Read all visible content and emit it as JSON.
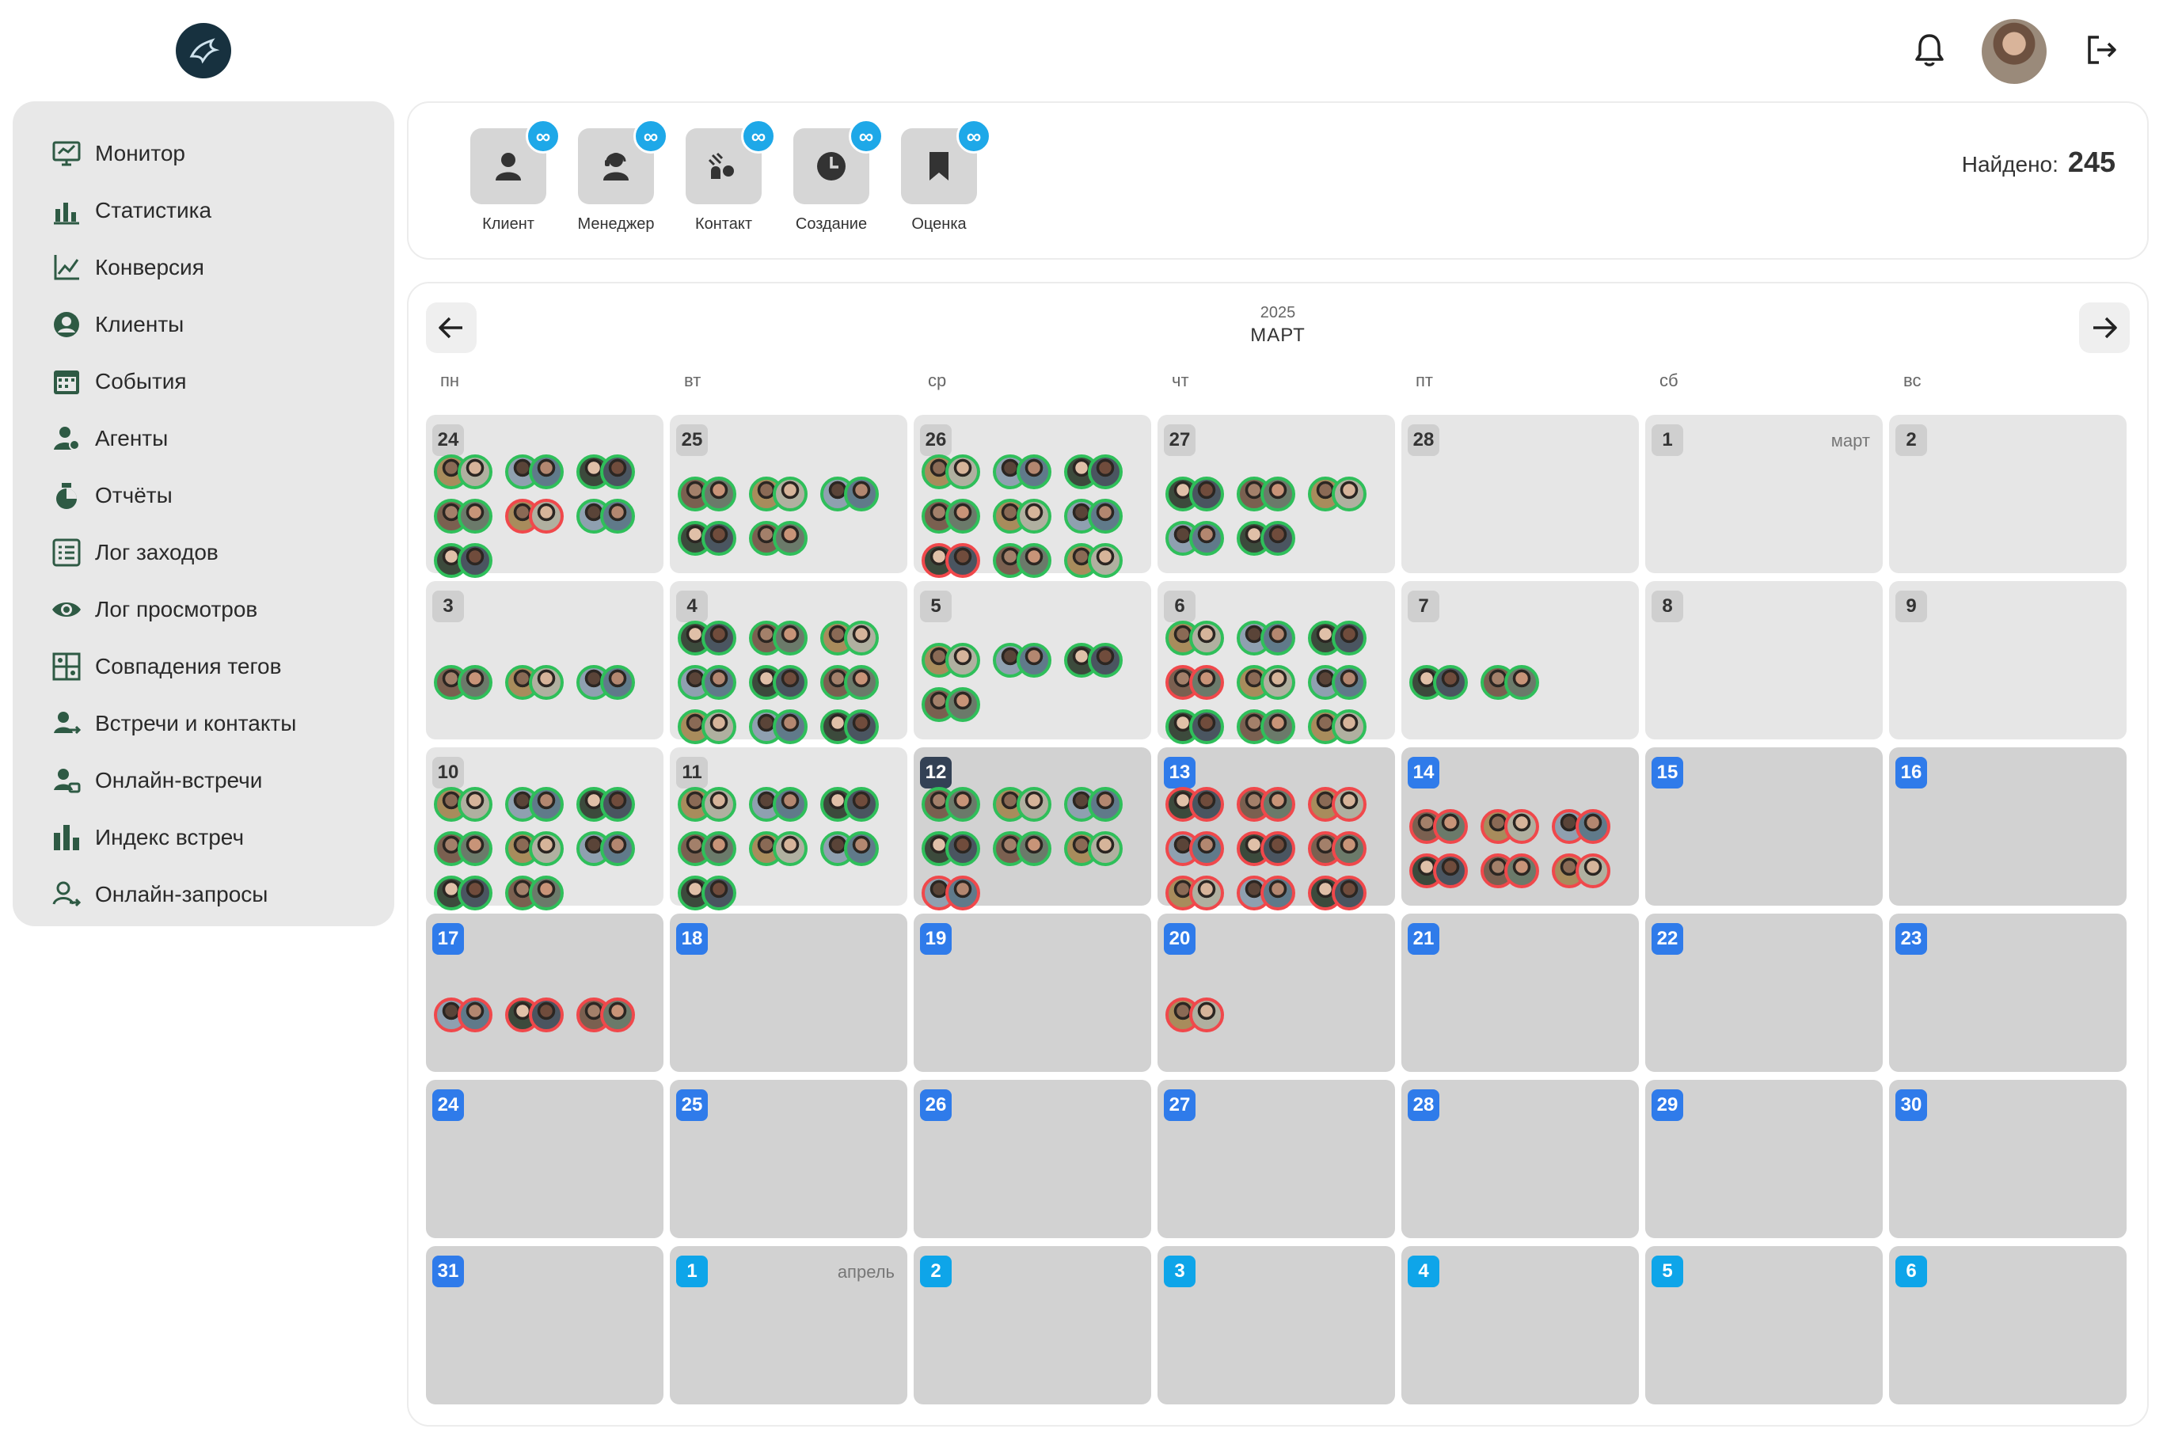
{
  "header": {
    "logo_icon": "pegasus-logo-icon",
    "notification_icon": "bell-icon",
    "logout_icon": "logout-icon"
  },
  "sidebar": {
    "items": [
      {
        "label": "Монитор",
        "icon": "monitor-icon"
      },
      {
        "label": "Статистика",
        "icon": "statistics-icon"
      },
      {
        "label": "Конверсия",
        "icon": "conversion-icon"
      },
      {
        "label": "Клиенты",
        "icon": "clients-icon"
      },
      {
        "label": "События",
        "icon": "calendar-icon"
      },
      {
        "label": "Агенты",
        "icon": "agents-icon"
      },
      {
        "label": "Отчёты",
        "icon": "reports-icon"
      },
      {
        "label": "Лог заходов",
        "icon": "list-icon"
      },
      {
        "label": "Лог просмотров",
        "icon": "eye-icon"
      },
      {
        "label": "Совпадения тегов",
        "icon": "tags-match-icon"
      },
      {
        "label": "Встречи и контакты",
        "icon": "meetings-icon"
      },
      {
        "label": "Онлайн-встречи",
        "icon": "online-meetings-icon"
      },
      {
        "label": "Индекс встреч",
        "icon": "bar-chart-icon"
      },
      {
        "label": "Онлайн-запросы",
        "icon": "online-requests-icon"
      }
    ]
  },
  "filters": {
    "items": [
      {
        "label": "Клиент",
        "badge": "∞",
        "icon": "person-icon"
      },
      {
        "label": "Менеджер",
        "badge": "∞",
        "icon": "manager-icon"
      },
      {
        "label": "Контакт",
        "badge": "∞",
        "icon": "contact-icon"
      },
      {
        "label": "Создание",
        "badge": "∞",
        "icon": "clock-icon"
      },
      {
        "label": "Оценка",
        "badge": "∞",
        "icon": "bookmark-icon"
      }
    ],
    "found_label": "Найдено:",
    "found_value": "245"
  },
  "calendar": {
    "year": "2025",
    "month": "МАРТ",
    "prev_icon": "arrow-left-icon",
    "next_icon": "arrow-right-icon",
    "weekdays": [
      "пн",
      "вт",
      "ср",
      "чт",
      "пт",
      "сб",
      "вс"
    ],
    "colors": {
      "green": "#2fbf5a",
      "red": "#f0484b",
      "blue": "#2f7bea",
      "cyan": "#0ea5e9",
      "dark": "#334155"
    },
    "days": [
      {
        "n": "24",
        "style": "gray",
        "past": true,
        "pairs": [
          "g",
          "g",
          "g",
          "g",
          "r",
          "g",
          "g"
        ]
      },
      {
        "n": "25",
        "style": "gray",
        "past": true,
        "pairs": [
          "g",
          "g",
          "g",
          "g",
          "g"
        ]
      },
      {
        "n": "26",
        "style": "gray",
        "past": true,
        "pairs": [
          "g",
          "g",
          "g",
          "g",
          "g",
          "g",
          "r",
          "g",
          "g",
          "g"
        ]
      },
      {
        "n": "27",
        "style": "gray",
        "past": true,
        "pairs": [
          "g",
          "g",
          "g",
          "g",
          "g"
        ]
      },
      {
        "n": "28",
        "style": "gray",
        "past": true,
        "pairs": []
      },
      {
        "n": "1",
        "style": "gray",
        "past": true,
        "month_label": "март",
        "pairs": []
      },
      {
        "n": "2",
        "style": "gray",
        "past": true,
        "pairs": []
      },
      {
        "n": "3",
        "style": "gray",
        "past": true,
        "pairs": [
          "g",
          "g",
          "g"
        ]
      },
      {
        "n": "4",
        "style": "gray",
        "past": true,
        "pairs": [
          "g",
          "g",
          "g",
          "g",
          "g",
          "g",
          "g",
          "g",
          "g",
          "g"
        ]
      },
      {
        "n": "5",
        "style": "gray",
        "past": true,
        "pairs": [
          "g",
          "g",
          "g",
          "g"
        ]
      },
      {
        "n": "6",
        "style": "gray",
        "past": true,
        "pairs": [
          "g",
          "g",
          "g",
          "r",
          "g",
          "g",
          "g",
          "g",
          "g",
          "r"
        ]
      },
      {
        "n": "7",
        "style": "gray",
        "past": true,
        "pairs": [
          "g",
          "g"
        ]
      },
      {
        "n": "8",
        "style": "gray",
        "past": true,
        "pairs": []
      },
      {
        "n": "9",
        "style": "gray",
        "past": true,
        "pairs": []
      },
      {
        "n": "10",
        "style": "gray",
        "past": true,
        "pairs": [
          "g",
          "g",
          "g",
          "g",
          "g",
          "g",
          "g",
          "g"
        ]
      },
      {
        "n": "11",
        "style": "gray",
        "past": true,
        "pairs": [
          "g",
          "g",
          "g",
          "g",
          "g",
          "g",
          "g"
        ]
      },
      {
        "n": "12",
        "style": "dark",
        "past": false,
        "pairs": [
          "g",
          "g",
          "g",
          "g",
          "g",
          "g",
          "r"
        ]
      },
      {
        "n": "13",
        "style": "blue",
        "past": false,
        "pairs": [
          "r",
          "r",
          "r",
          "r",
          "r",
          "r",
          "r",
          "r",
          "r"
        ]
      },
      {
        "n": "14",
        "style": "blue",
        "past": false,
        "pairs": [
          "r",
          "r",
          "r",
          "r",
          "r",
          "r"
        ]
      },
      {
        "n": "15",
        "style": "blue",
        "past": false,
        "pairs": []
      },
      {
        "n": "16",
        "style": "blue",
        "past": false,
        "pairs": []
      },
      {
        "n": "17",
        "style": "blue",
        "past": false,
        "pairs": [
          "r",
          "r",
          "r"
        ]
      },
      {
        "n": "18",
        "style": "blue",
        "past": false,
        "pairs": []
      },
      {
        "n": "19",
        "style": "blue",
        "past": false,
        "pairs": []
      },
      {
        "n": "20",
        "style": "blue",
        "past": false,
        "pairs": [
          "r"
        ]
      },
      {
        "n": "21",
        "style": "blue",
        "past": false,
        "pairs": []
      },
      {
        "n": "22",
        "style": "blue",
        "past": false,
        "pairs": []
      },
      {
        "n": "23",
        "style": "blue",
        "past": false,
        "pairs": []
      },
      {
        "n": "24",
        "style": "blue",
        "past": false,
        "pairs": []
      },
      {
        "n": "25",
        "style": "blue",
        "past": false,
        "pairs": []
      },
      {
        "n": "26",
        "style": "blue",
        "past": false,
        "pairs": []
      },
      {
        "n": "27",
        "style": "blue",
        "past": false,
        "pairs": []
      },
      {
        "n": "28",
        "style": "blue",
        "past": false,
        "pairs": []
      },
      {
        "n": "29",
        "style": "blue",
        "past": false,
        "pairs": []
      },
      {
        "n": "30",
        "style": "blue",
        "past": false,
        "pairs": []
      },
      {
        "n": "31",
        "style": "blue",
        "past": false,
        "pairs": []
      },
      {
        "n": "1",
        "style": "cyan",
        "past": false,
        "month_label": "апрель",
        "pairs": []
      },
      {
        "n": "2",
        "style": "cyan",
        "past": false,
        "pairs": []
      },
      {
        "n": "3",
        "style": "cyan",
        "past": false,
        "pairs": []
      },
      {
        "n": "4",
        "style": "cyan",
        "past": false,
        "pairs": []
      },
      {
        "n": "5",
        "style": "cyan",
        "past": false,
        "pairs": []
      },
      {
        "n": "6",
        "style": "cyan",
        "past": false,
        "pairs": []
      }
    ]
  }
}
